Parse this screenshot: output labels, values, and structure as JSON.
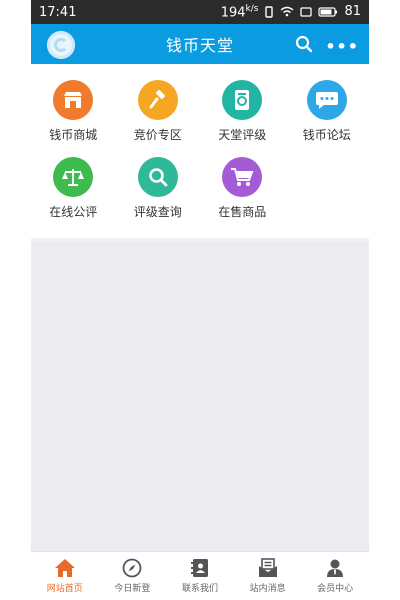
{
  "status_bar": {
    "time": "17:41",
    "speed": "194",
    "speed_unit": "k/s",
    "battery": "81"
  },
  "header": {
    "title": "钱币天堂",
    "more": "•••"
  },
  "menu": [
    {
      "label": "钱币商城",
      "icon": "shop-icon",
      "color": "#f07b2c"
    },
    {
      "label": "竞价专区",
      "icon": "auction-hammer-icon",
      "color": "#f5a623"
    },
    {
      "label": "天堂评级",
      "icon": "grading-icon",
      "color": "#23b5a4"
    },
    {
      "label": "钱币论坛",
      "icon": "forum-chat-icon",
      "color": "#2da7e6"
    },
    {
      "label": "在线公评",
      "icon": "scale-icon",
      "color": "#3dbb4e"
    },
    {
      "label": "评级查询",
      "icon": "search-query-icon",
      "color": "#2fb89a"
    },
    {
      "label": "在售商品",
      "icon": "cart-icon",
      "color": "#a35cd6"
    }
  ],
  "tabs": [
    {
      "label": "网站首页",
      "icon": "home-icon",
      "active": true
    },
    {
      "label": "今日新登",
      "icon": "compass-icon",
      "active": false
    },
    {
      "label": "联系我们",
      "icon": "contacts-icon",
      "active": false
    },
    {
      "label": "站内消息",
      "icon": "message-icon",
      "active": false
    },
    {
      "label": "会员中心",
      "icon": "member-icon",
      "active": false
    }
  ],
  "colors": {
    "header": "#0a9be0",
    "active_tab": "#e86a2a"
  }
}
